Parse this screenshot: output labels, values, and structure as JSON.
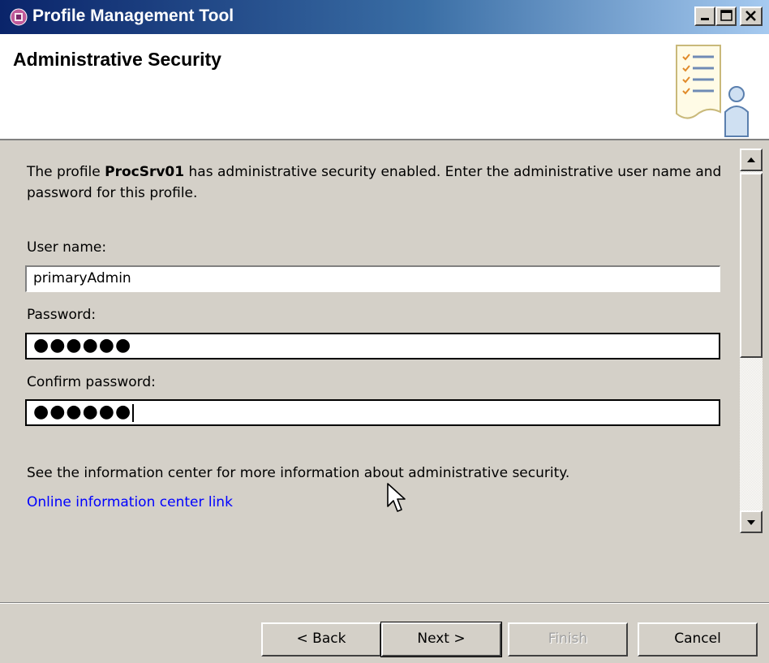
{
  "window": {
    "title": "Profile Management Tool",
    "buttons": [
      "minimize",
      "maximize",
      "close"
    ]
  },
  "header": {
    "title": "Administrative Security"
  },
  "content": {
    "intro_prefix": "The profile ",
    "profile_name": "ProcSrv01",
    "intro_suffix": " has administrative security enabled.  Enter the administrative user name and password for this profile.",
    "username": {
      "label": "User name:",
      "value": "primaryAdmin"
    },
    "password": {
      "label": "Password:",
      "value": "●●●●●●"
    },
    "confirm_password": {
      "label": "Confirm password:",
      "value": "●●●●●●"
    },
    "info_text": "See the information center for more information about administrative security.",
    "info_link": "Online information center link"
  },
  "footer": {
    "back_label": "< Back",
    "next_label": "Next >",
    "finish_label": "Finish",
    "cancel_label": "Cancel"
  },
  "colors": {
    "title_bar": "#0a246a",
    "link": "#0000ff",
    "dialog_bg": "#d4d0c8"
  }
}
